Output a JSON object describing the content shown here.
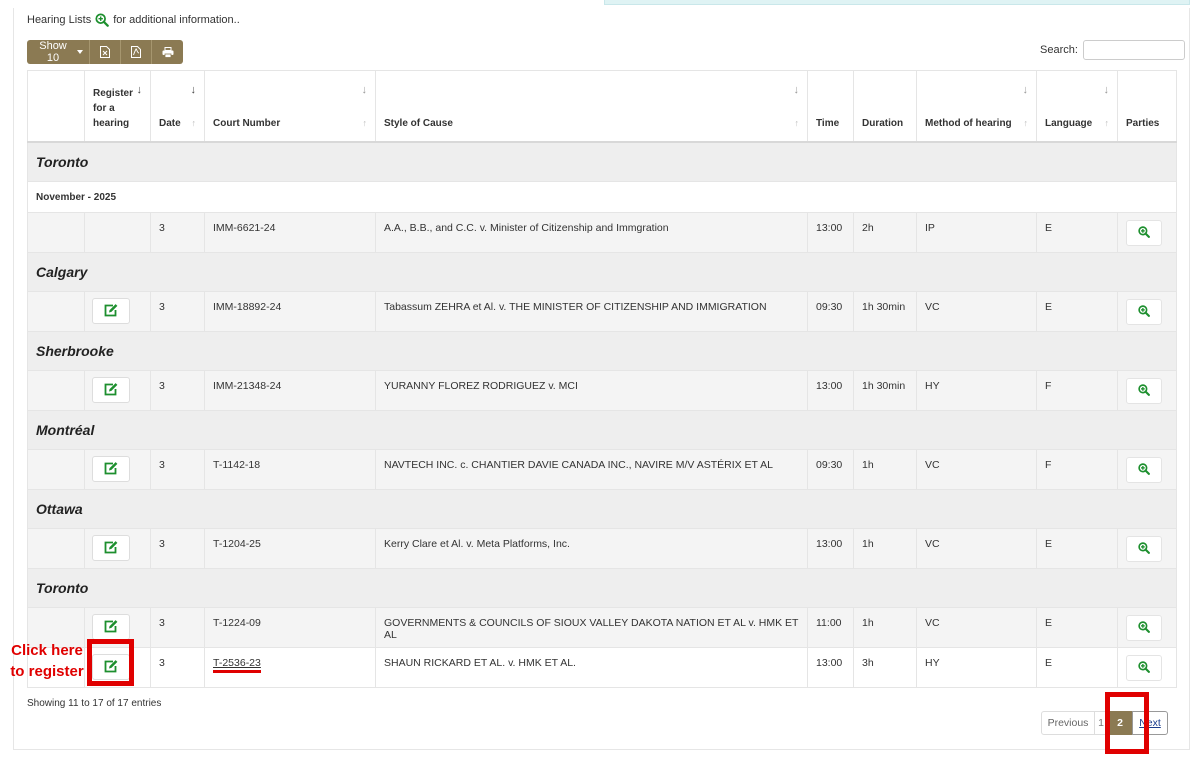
{
  "info": {
    "prefix": "Hearing Lists",
    "suffix": "for additional information.."
  },
  "toolbar": {
    "show_label": "Show 10",
    "excel_icon": "excel-file-icon",
    "pdf_icon": "pdf-file-icon",
    "print_icon": "print-icon"
  },
  "search": {
    "label": "Search:",
    "value": ""
  },
  "columns": {
    "register": "Register for a hearing",
    "date": "Date",
    "court": "Court Number",
    "style": "Style of Cause",
    "time": "Time",
    "duration": "Duration",
    "method": "Method of hearing",
    "language": "Language",
    "parties": "Parties"
  },
  "groups": [
    {
      "city": "Toronto",
      "month": "November - 2025",
      "rows": [
        {
          "register": false,
          "date": "3",
          "court": "IMM-6621-24",
          "style": "A.A., B.B., and C.C. v. Minister of Citizenship and Immgration",
          "time": "13:00",
          "duration": "2h",
          "method": "IP",
          "language": "E"
        }
      ]
    },
    {
      "city": "Calgary",
      "rows": [
        {
          "register": true,
          "date": "3",
          "court": "IMM-18892-24",
          "style": "Tabassum ZEHRA et Al. v. THE MINISTER OF CITIZENSHIP AND IMMIGRATION",
          "time": "09:30",
          "duration": "1h 30min",
          "method": "VC",
          "language": "E"
        }
      ]
    },
    {
      "city": "Sherbrooke",
      "rows": [
        {
          "register": true,
          "date": "3",
          "court": "IMM-21348-24",
          "style": "YURANNY FLOREZ RODRIGUEZ v. MCI",
          "time": "13:00",
          "duration": "1h 30min",
          "method": "HY",
          "language": "F"
        }
      ]
    },
    {
      "city": "Montréal",
      "rows": [
        {
          "register": true,
          "date": "3",
          "court": "T-1142-18",
          "style": "NAVTECH INC. c. CHANTIER DAVIE CANADA INC., NAVIRE M/V ASTÉRIX ET AL",
          "time": "09:30",
          "duration": "1h",
          "method": "VC",
          "language": "F"
        }
      ]
    },
    {
      "city": "Ottawa",
      "rows": [
        {
          "register": true,
          "date": "3",
          "court": "T-1204-25",
          "style": "Kerry Clare et Al. v. Meta Platforms, Inc.",
          "time": "13:00",
          "duration": "1h",
          "method": "VC",
          "language": "E"
        }
      ]
    },
    {
      "city": "Toronto",
      "rows": [
        {
          "register": true,
          "date": "3",
          "court": "T-1224-09",
          "style": "GOVERNMENTS & COUNCILS OF SIOUX VALLEY DAKOTA NATION ET AL v. HMK ET AL",
          "time": "11:00",
          "duration": "1h",
          "method": "VC",
          "language": "E"
        },
        {
          "register": true,
          "date": "3",
          "court": "T-2536-23",
          "style": "SHAUN RICKARD ET AL. v. HMK ET AL.",
          "time": "13:00",
          "duration": "3h",
          "method": "HY",
          "language": "E",
          "highlight": true
        }
      ]
    }
  ],
  "footer": {
    "entries": "Showing 11 to 17 of 17 entries"
  },
  "pagination": {
    "previous": "Previous",
    "page1": "1",
    "current": "2",
    "next": "Next"
  },
  "annotation": {
    "line1": "Click here",
    "line2": "to register"
  },
  "colors": {
    "accent": "#8b7a53",
    "icon_green": "#1d8f2e",
    "highlight_red": "#e00000"
  }
}
